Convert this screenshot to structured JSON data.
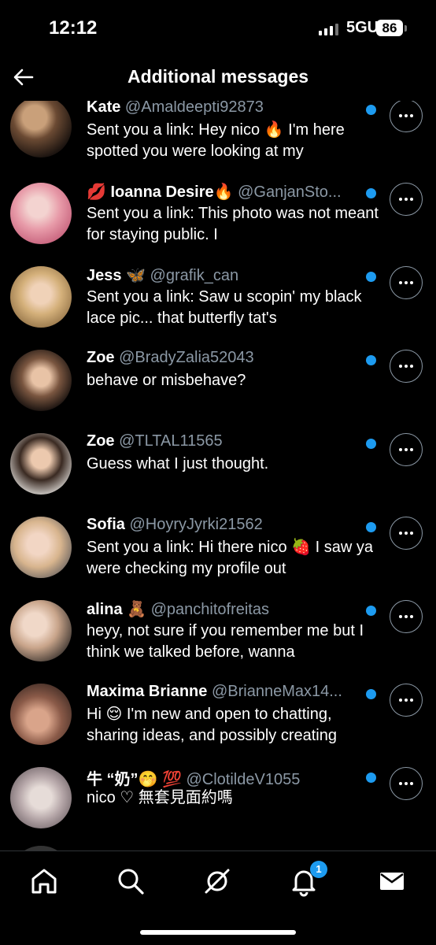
{
  "status_bar": {
    "time": "12:12",
    "network": "5GUC",
    "battery": "86"
  },
  "header": {
    "title": "Additional messages"
  },
  "messages": [
    {
      "name": "Kate",
      "handle": "@Amaldeepti92873",
      "preview": "Sent you a link: Hey nico 🔥 I'm here spotted you were looking at my"
    },
    {
      "name": "💋 Ioanna Desire🔥",
      "handle": "@GanjanSto...",
      "preview": "Sent you a link: This photo was not meant for staying public. I"
    },
    {
      "name": "Jess 🦋",
      "handle": "@grafik_can",
      "preview": "Sent you a link: Saw u scopin' my black lace pic... that butterfly tat's"
    },
    {
      "name": "Zoe",
      "handle": "@BradyZalia52043",
      "preview": "behave or misbehave?"
    },
    {
      "name": "Zoe",
      "handle": "@TLTAL11565",
      "preview": "Guess what I just thought."
    },
    {
      "name": "Sofia",
      "handle": "@HoyryJyrki21562",
      "preview": "Sent you a link: Hi there nico 🍓 I saw ya were checking my profile out"
    },
    {
      "name": "alina 🧸",
      "handle": "@panchitofreitas",
      "preview": "heyy, not sure if you remember me but I think we talked before, wanna"
    },
    {
      "name": "Maxima Brianne",
      "handle": "@BrianneMax14...",
      "preview": "Hi 😌 I'm new and open to chatting, sharing ideas, and possibly creating"
    },
    {
      "name": "牛 “奶”🤭 💯",
      "handle": "@ClotildeV1055",
      "preview": "nico ♡ 無套見面約嗎"
    }
  ],
  "tabbar": {
    "items": [
      "home-icon",
      "search-icon",
      "grok-icon",
      "notifications-icon",
      "messages-icon"
    ],
    "notification_count": "1"
  },
  "colors": {
    "accent": "#1d9bf0",
    "background": "#000000",
    "secondary_text": "#8b98a5"
  }
}
